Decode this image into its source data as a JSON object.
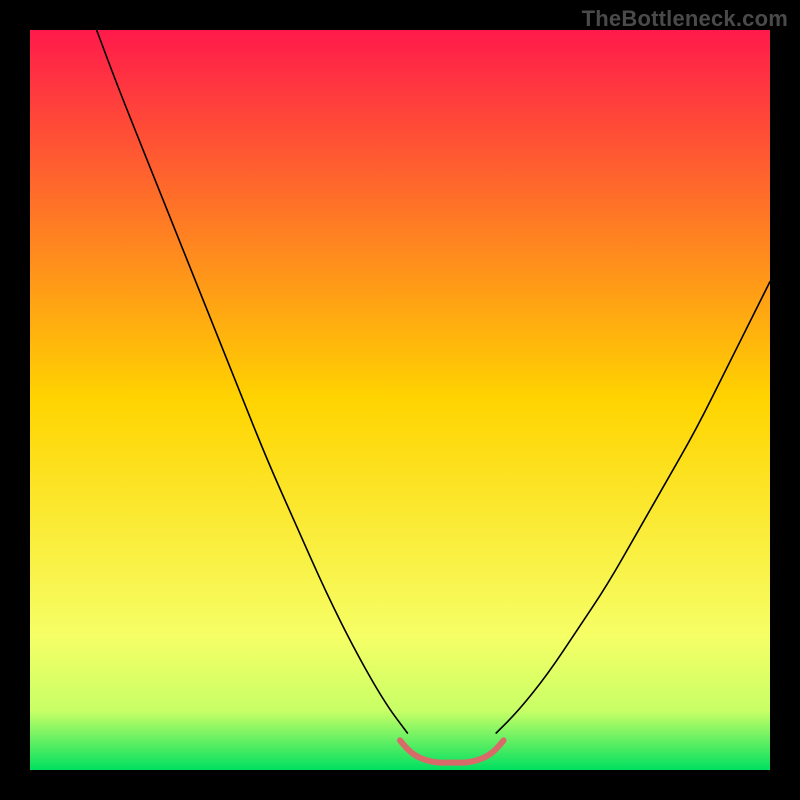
{
  "watermark": {
    "text": "TheBottleneck.com"
  },
  "chart_data": {
    "type": "line",
    "title": "",
    "xlabel": "",
    "ylabel": "",
    "xlim": [
      0,
      100
    ],
    "ylim": [
      0,
      100
    ],
    "legend": false,
    "grid": false,
    "background_gradient": {
      "stops": [
        {
          "offset": 0.0,
          "color": "#ff1a4b"
        },
        {
          "offset": 0.5,
          "color": "#ffd400"
        },
        {
          "offset": 0.82,
          "color": "#f6ff66"
        },
        {
          "offset": 0.92,
          "color": "#c8ff66"
        },
        {
          "offset": 1.0,
          "color": "#00e060"
        }
      ]
    },
    "series": [
      {
        "name": "curve-left",
        "color": "#000000",
        "stroke_width": 1.6,
        "x": [
          9,
          12,
          16,
          20,
          24,
          28,
          32,
          36,
          40,
          44,
          48,
          51
        ],
        "values": [
          100,
          92,
          82,
          72,
          62,
          52,
          42,
          33,
          24,
          16,
          9,
          5
        ]
      },
      {
        "name": "curve-right",
        "color": "#000000",
        "stroke_width": 1.6,
        "x": [
          63,
          66,
          70,
          74,
          78,
          82,
          86,
          90,
          94,
          98,
          100
        ],
        "values": [
          5,
          8,
          13,
          19,
          25,
          32,
          39,
          46,
          54,
          62,
          66
        ]
      },
      {
        "name": "bottom-band",
        "color": "#d96a6a",
        "stroke_width": 6,
        "x": [
          50,
          51,
          52,
          53,
          54,
          55,
          56,
          57,
          58,
          59,
          60,
          61,
          62,
          63,
          64
        ],
        "values": [
          4,
          2.8,
          2.0,
          1.5,
          1.2,
          1.0,
          1.0,
          1.0,
          1.0,
          1.0,
          1.2,
          1.5,
          2.0,
          2.8,
          4
        ]
      }
    ]
  }
}
